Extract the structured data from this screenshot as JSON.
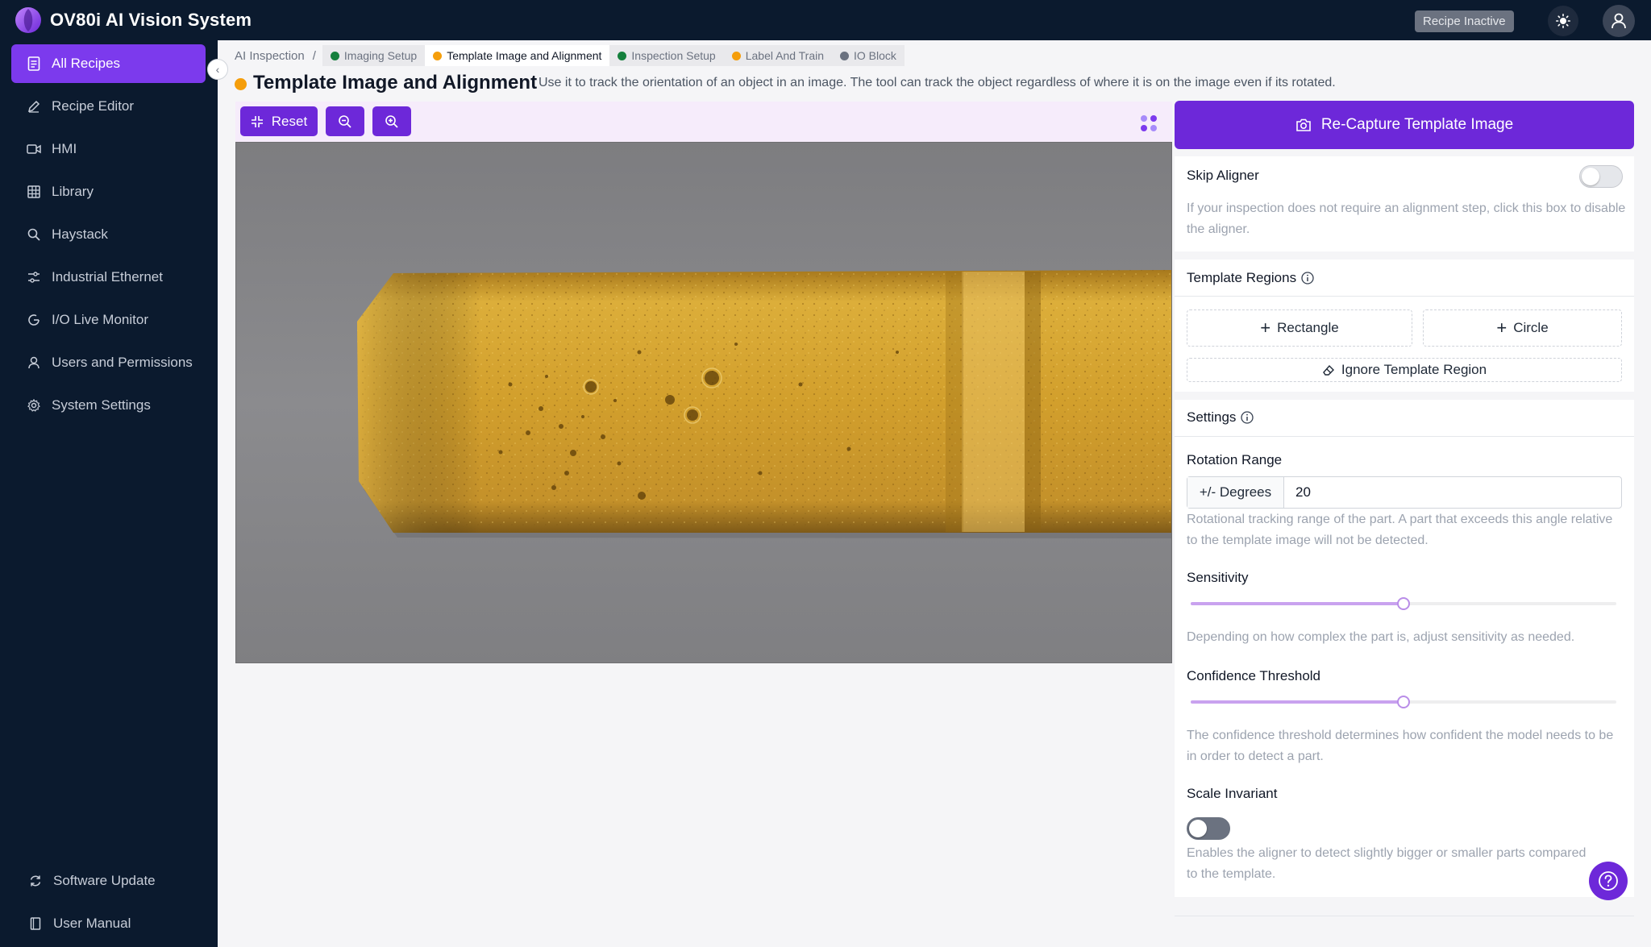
{
  "app": {
    "title": "OV80i AI Vision System",
    "recipe_status": "Recipe Inactive"
  },
  "sidebar": {
    "items": [
      {
        "label": "All Recipes",
        "icon": "document-icon",
        "active": true
      },
      {
        "label": "Recipe Editor",
        "icon": "pencil-icon"
      },
      {
        "label": "HMI",
        "icon": "video-icon"
      },
      {
        "label": "Library",
        "icon": "grid-icon"
      },
      {
        "label": "Haystack",
        "icon": "search-icon"
      },
      {
        "label": "Industrial Ethernet",
        "icon": "network-icon"
      },
      {
        "label": "I/O Live Monitor",
        "icon": "refresh-icon"
      },
      {
        "label": "Users and Permissions",
        "icon": "user-icon"
      },
      {
        "label": "System Settings",
        "icon": "gear-icon"
      }
    ],
    "footer": [
      {
        "label": "Software Update",
        "icon": "sync-icon"
      },
      {
        "label": "User Manual",
        "icon": "book-icon"
      }
    ]
  },
  "breadcrumb": {
    "root": "AI Inspection",
    "separator": "/",
    "steps": [
      {
        "label": "Imaging Setup",
        "status_color": "#15803d"
      },
      {
        "label": "Template Image and Alignment",
        "status_color": "#f59e0b",
        "active": true
      },
      {
        "label": "Inspection Setup",
        "status_color": "#15803d"
      },
      {
        "label": "Label And Train",
        "status_color": "#f59e0b"
      },
      {
        "label": "IO Block",
        "status_color": "#6b7280"
      }
    ]
  },
  "page": {
    "title": "Template Image and Alignment",
    "description": "Use it to track the orientation of an object in an image. The tool can track the object regardless of where it is on the image even if its rotated."
  },
  "toolbar": {
    "reset_label": "Reset",
    "zoom_out_icon": "zoom-out-icon",
    "zoom_in_icon": "zoom-in-icon"
  },
  "right_panel": {
    "recapture_label": "Re-Capture Template Image",
    "skip_aligner": {
      "label": "Skip Aligner",
      "enabled": false,
      "help": "If your inspection does not require an alignment step, click this box to disable the aligner."
    },
    "template_regions": {
      "title": "Template Regions",
      "rectangle_label": "Rectangle",
      "circle_label": "Circle",
      "ignore_label": "Ignore Template Region"
    },
    "settings": {
      "title": "Settings",
      "rotation_range": {
        "label": "Rotation Range",
        "addon": "+/- Degrees",
        "value": "20",
        "help": "Rotational tracking range of the part. A part that exceeds this angle relative to the template image will not be detected."
      },
      "sensitivity": {
        "label": "Sensitivity",
        "value_fraction": 0.5,
        "help": "Depending on how complex the part is, adjust sensitivity as needed."
      },
      "confidence_threshold": {
        "label": "Confidence Threshold",
        "value_fraction": 0.5,
        "help": "The confidence threshold determines how confident the model needs to be in order to detect a part."
      },
      "scale_invariant": {
        "label": "Scale Invariant",
        "enabled": false,
        "help": "Enables the aligner to detect slightly bigger or smaller parts compared to the template."
      }
    }
  },
  "colors": {
    "accent": "#6d28d9",
    "nav_bg": "#0b1a2e",
    "active_nav": "#7c3aed"
  }
}
